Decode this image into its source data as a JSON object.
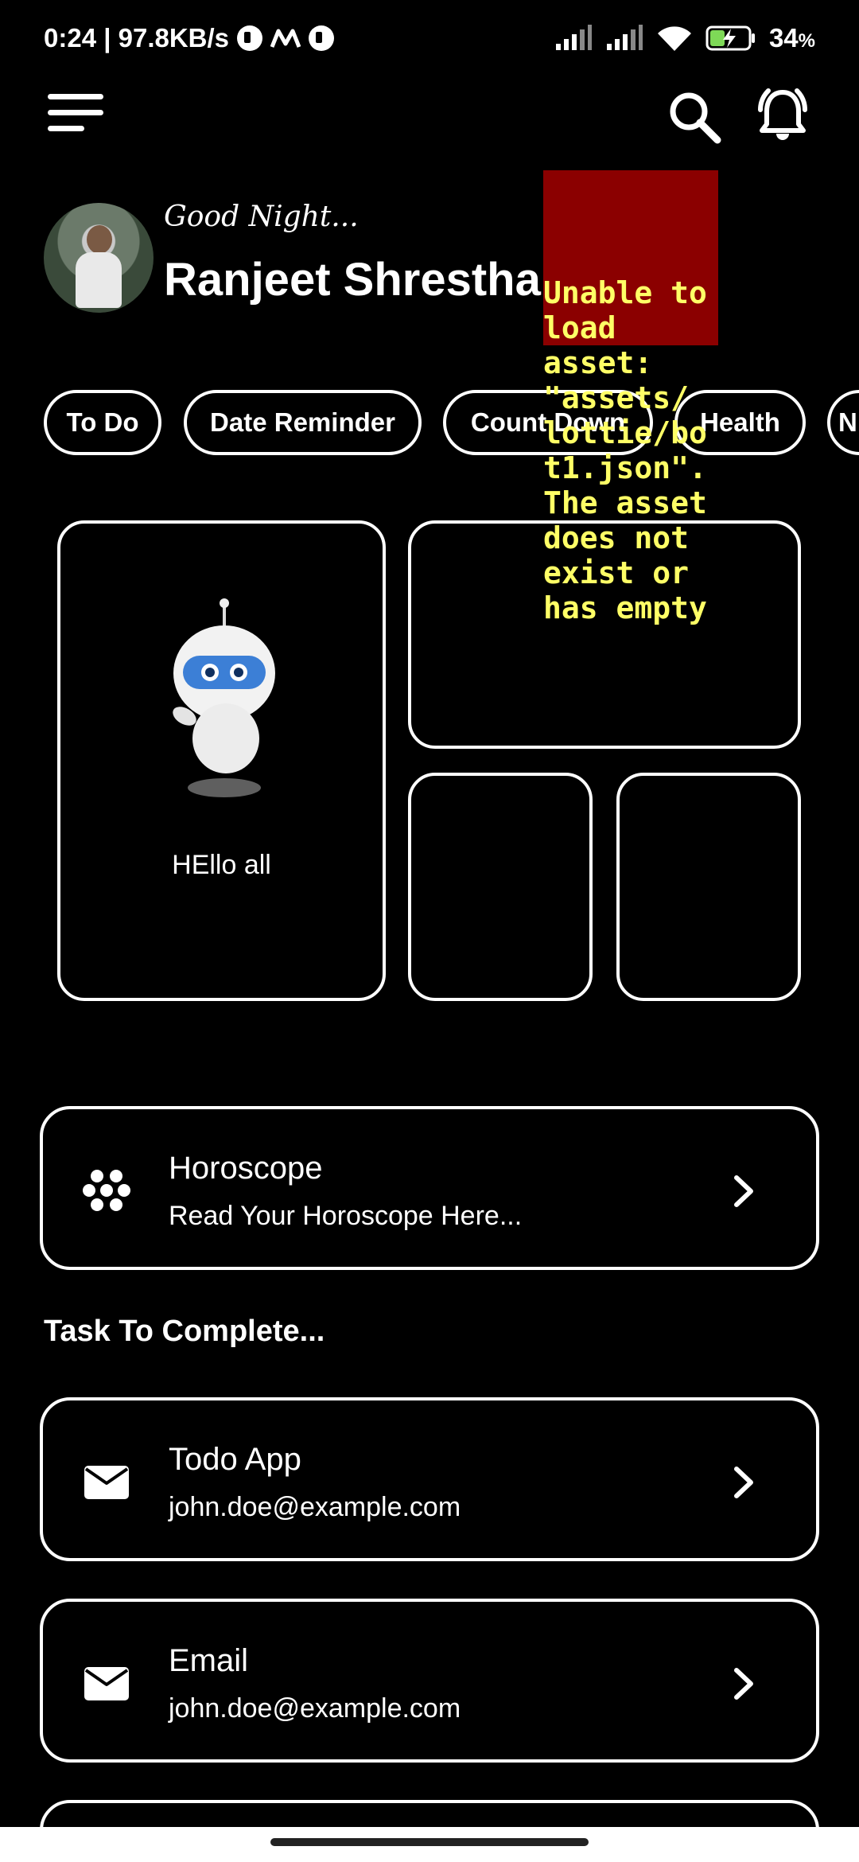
{
  "status_bar": {
    "time_speed": "0:24 | 97.8KB/s",
    "battery": "34",
    "battery_unit": "%"
  },
  "header": {
    "greeting": "Good Night...",
    "user_name": "Ranjeet Shrestha",
    "asset_error": "Unable to\nload\nasset:\n\"assets/\nlottie/bo\nt1.json\".\nThe asset\ndoes not\nexist or\nhas empty"
  },
  "chips": [
    "To Do",
    "Date Reminder",
    "Count Down",
    "Health",
    "N"
  ],
  "bot_card": {
    "caption": "HEllo all"
  },
  "horoscope": {
    "title": "Horoscope",
    "subtitle": "Read Your Horoscope Here..."
  },
  "tasks_section": {
    "title": "Task To Complete..."
  },
  "tasks": [
    {
      "title": "Todo App",
      "subtitle": "john.doe@example.com"
    },
    {
      "title": "Email",
      "subtitle": "john.doe@example.com"
    }
  ],
  "colors": {
    "background": "#000000",
    "foreground": "#ffffff",
    "error_bg": "#8b0000",
    "error_text": "#ffff66"
  }
}
